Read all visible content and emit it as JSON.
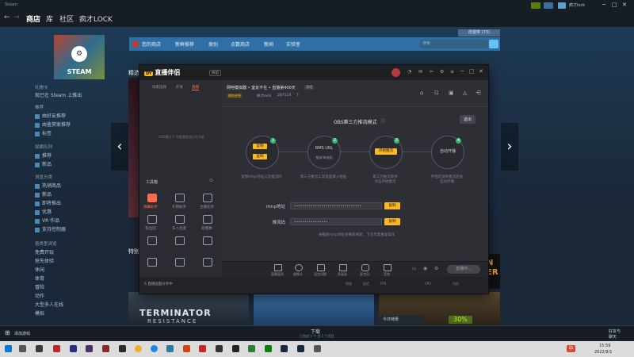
{
  "titlebar": {
    "title": "Steam",
    "username": "疯才lock",
    "window_controls": [
      "─",
      "□",
      "✕"
    ]
  },
  "navbar": {
    "back": "←",
    "forward": "→",
    "items": [
      "商店",
      "库",
      "社区",
      "疯才LOCK"
    ]
  },
  "store": {
    "menu": [
      "您的商店",
      "新鲜推荐",
      "类别",
      "点数商店",
      "新闻",
      "实验室"
    ],
    "wishlist": "愿望单 (73)",
    "search_placeholder": "搜索",
    "logo_text": "STEAM",
    "featured_label": "精选",
    "special_label": "特别",
    "sidebar": {
      "giftcard_h": "礼物卡",
      "giftcard_i": "现已在 Steam 上推出",
      "recommend_h": "推荐",
      "recommend_items": [
        "由好友推荐",
        "由鉴赏家推荐",
        "标签"
      ],
      "discover_h": "探索队列",
      "discover_items": [
        "推荐",
        "新品"
      ],
      "browse_h": "浏览分类",
      "browse_items": [
        "热销商品",
        "新品",
        "即将推出",
        "优惠",
        "VR 作品",
        "支持控制器"
      ],
      "genre_h": "按类型浏览",
      "genre_items": [
        "免费开玩",
        "抢先体验",
        "休闲",
        "体育",
        "冒险",
        "动作",
        "大型多人在线",
        "模拟"
      ]
    },
    "tiles": {
      "terminator": "TERMINATOR",
      "resistance": "RESISTANCE",
      "today_deal": "今日特惠",
      "discount": "30%",
      "right_text": "N\nER"
    }
  },
  "dlbar": {
    "add_game": "添加游戏",
    "download_title": "下载",
    "download_sub": "已完成 1 个 共 1 个项目",
    "friends": "好友与",
    "chat": "聊天"
  },
  "taskbar": {
    "time": "15:59",
    "date": "2022/9/1",
    "ime": "中"
  },
  "live": {
    "logo_text": "直播伴侣",
    "logo_badge": "DY",
    "badge_beta": "体验",
    "left_tabs": [
      "场景选择",
      "开发",
      "直播"
    ],
    "left_hint": "OBS模式下 你需要推流后可开始",
    "tools_title": "工具箱",
    "tools": [
      "弹幕助手",
      "礼物助手",
      "主播任务",
      "粉丝团",
      "多人连麦",
      "观看数",
      "",
      "",
      "",
      "",
      "",
      ""
    ],
    "stream_title": "网吧模拟器 • 室友不在 • 直播第400天",
    "stream_tag": "游戏",
    "stream_category": "模拟经营",
    "streamer": "疯才lock",
    "fans": "287114",
    "likes": "7",
    "mode_title": "OBS第三方推流模式",
    "exit_btn": "退出",
    "steps": [
      {
        "num": "1",
        "btn1": "复制",
        "btn2": "复制",
        "desc": "复制rtmp地址以及推流码"
      },
      {
        "num": "2",
        "btn1": "RMS URL",
        "btn2": "推流/串流码",
        "desc": "第三方推流工具里面填入粘贴"
      },
      {
        "num": "3",
        "btn1": "开始推流",
        "desc": "第三方推流软件\n点击开始推流"
      },
      {
        "num": "4",
        "btn1": "自动开播",
        "desc": "伴侣检测到推流后会\n自动开播"
      }
    ],
    "rtmp_label": "rtmp地址",
    "rtmp_value": "••••••••••••••••••••••••••••••••",
    "key_label": "推流码",
    "key_value": "••••••••••••••••",
    "copy": "复制",
    "note": "关播后rtmp地址会重新刷新，下次无需重复操作",
    "bottom_tools": [
      "直播画质",
      "摄像头",
      "语言切换",
      "多画面",
      "麦克风",
      "音效"
    ],
    "end_live": "直播中...",
    "status_share": "S 直播画面分享中",
    "status_items": [
      "网络",
      "延迟",
      "FPS",
      "CPU",
      "内存"
    ]
  },
  "colors": {
    "steam_bg": "#1b2838",
    "steam_menu": "#2f6fa5",
    "live_accent": "#fdb722",
    "live_green": "#2eb872"
  }
}
